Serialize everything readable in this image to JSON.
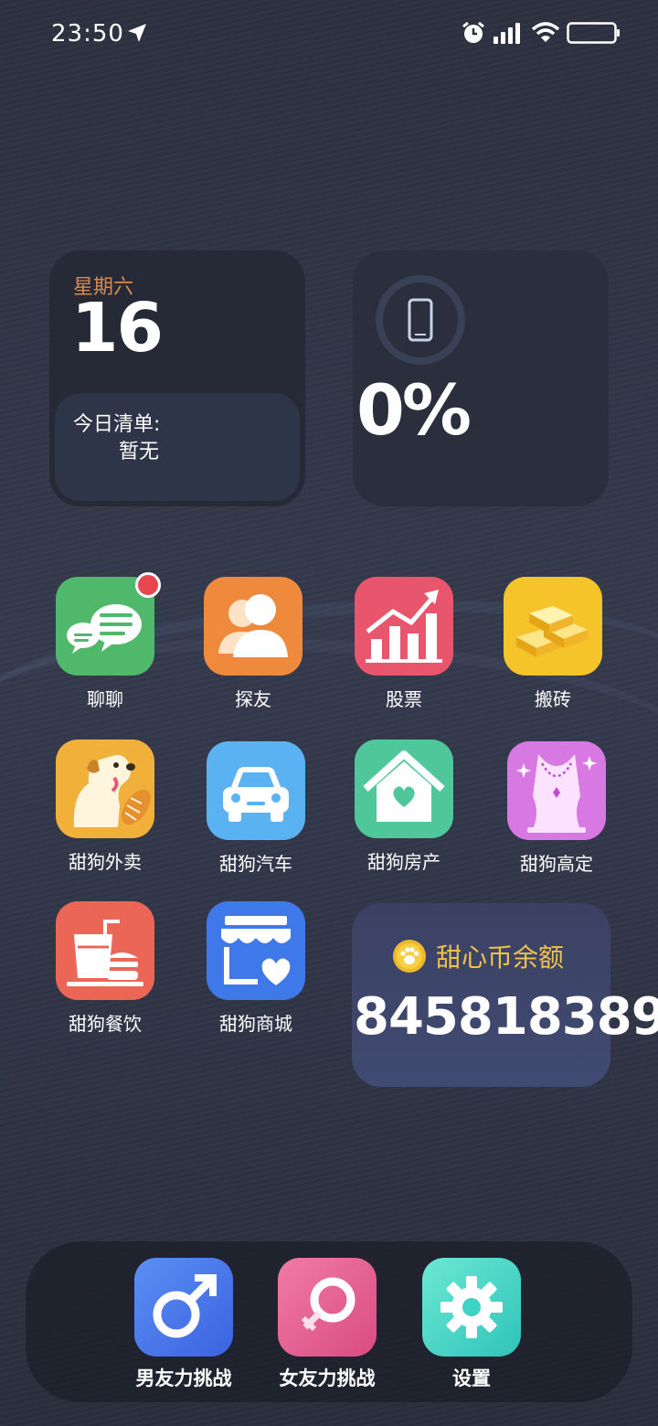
{
  "status_bar": {
    "time": "23:50",
    "icons": [
      "location-arrow-icon",
      "alarm-icon",
      "signal-icon",
      "wifi-icon",
      "battery-icon"
    ]
  },
  "date_widget": {
    "weekday": "星期六",
    "day": "16",
    "todo_title": "今日清单:",
    "todo_empty": "暂无"
  },
  "battery_widget": {
    "percent_text": "0%",
    "icon": "phone-icon"
  },
  "apps": [
    {
      "label": "聊聊",
      "icon": "chat-icon",
      "color": "#4fb86a",
      "has_badge": true
    },
    {
      "label": "探友",
      "icon": "friends-icon",
      "color": "#ef8a3c"
    },
    {
      "label": "股票",
      "icon": "stock-chart-icon",
      "color": "#e8566e"
    },
    {
      "label": "搬砖",
      "icon": "gold-bars-icon",
      "color": "#f5c42a"
    },
    {
      "label": "甜狗外卖",
      "icon": "dog-delivery-icon",
      "color": "#f0b03a"
    },
    {
      "label": "甜狗汽车",
      "icon": "car-icon",
      "color": "#5ab2f2"
    },
    {
      "label": "甜狗房产",
      "icon": "house-icon",
      "color": "#4fc79a"
    },
    {
      "label": "甜狗高定",
      "icon": "necklace-icon",
      "color": "#d878e2"
    },
    {
      "label": "甜狗餐饮",
      "icon": "food-icon",
      "color": "#ec6657"
    },
    {
      "label": "甜狗商城",
      "icon": "shop-icon",
      "color": "#3f78e8"
    }
  ],
  "coin_widget": {
    "title": "甜心币余额",
    "amount": "845818389",
    "icon": "paw-coin-icon"
  },
  "dock": [
    {
      "label": "男友力挑战",
      "icon": "male-symbol-icon",
      "color": "#4f7ef0"
    },
    {
      "label": "女友力挑战",
      "icon": "female-symbol-icon",
      "color": "#e8618f"
    },
    {
      "label": "设置",
      "icon": "gear-icon",
      "color": "#3fd3c4"
    }
  ]
}
